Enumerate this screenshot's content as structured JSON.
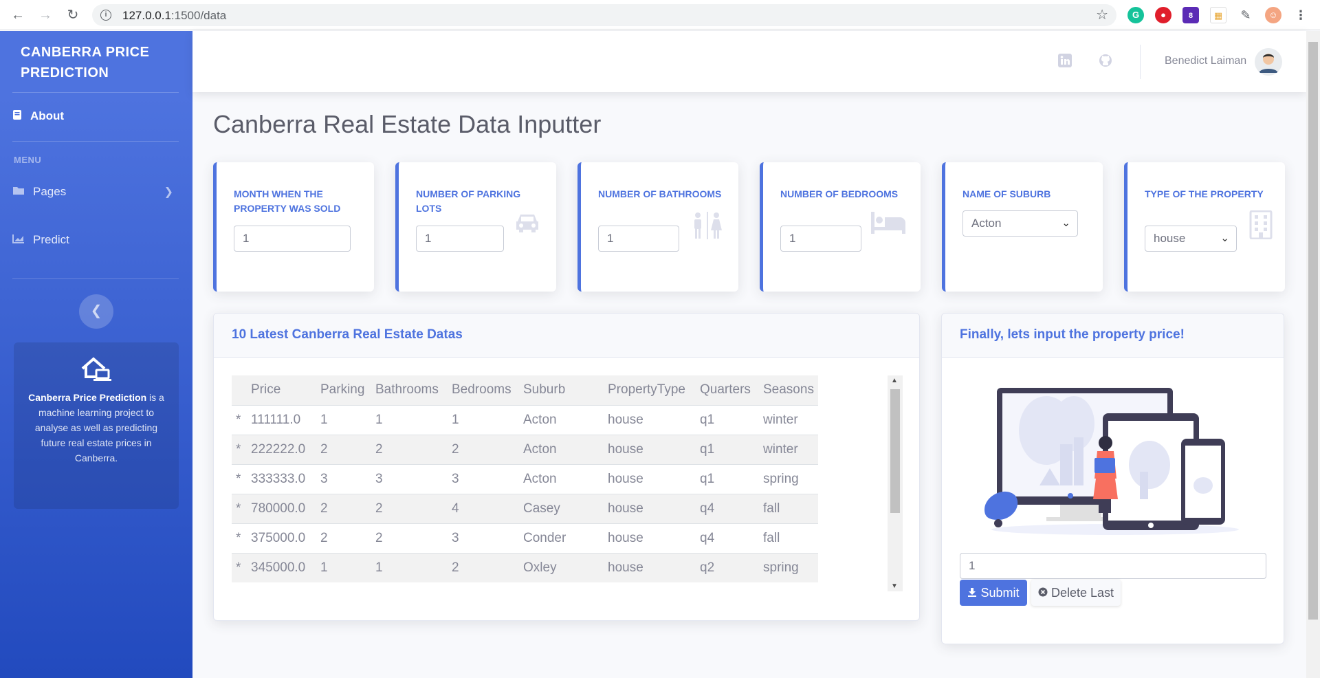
{
  "browser": {
    "url_host": "127.0.0.1",
    "url_path": ":1500/data",
    "ext_badge": "8"
  },
  "sidebar": {
    "brand": "CANBERRA PRICE PREDICTION",
    "about_label": "About",
    "menu_heading": "MENU",
    "pages_label": "Pages",
    "predict_label": "Predict",
    "card_title": "Canberra Price Prediction",
    "card_text": " is a machine learning project to analyse as well as predicting future real estate prices in Canberra."
  },
  "topbar": {
    "user_name": "Benedict Laiman"
  },
  "page": {
    "title": "Canberra Real Estate Data Inputter"
  },
  "inputs": {
    "month": {
      "label": "MONTH WHEN THE PROPERTY WAS SOLD",
      "value": "1"
    },
    "parking": {
      "label": "NUMBER OF PARKING LOTS",
      "value": "1"
    },
    "bathrooms": {
      "label": "NUMBER OF BATHROOMS",
      "value": "1"
    },
    "bedrooms": {
      "label": "NUMBER OF BEDROOMS",
      "value": "1"
    },
    "suburb": {
      "label": "NAME OF SUBURB",
      "value": "Acton"
    },
    "type": {
      "label": "TYPE OF THE PROPERTY",
      "value": "house"
    }
  },
  "table_card": {
    "title": "10 Latest Canberra Real Estate Datas",
    "columns": [
      "",
      "Price",
      "Parking",
      "Bathrooms",
      "Bedrooms",
      "Suburb",
      "PropertyType",
      "Quarters",
      "Seasons"
    ],
    "rows": [
      [
        "*",
        "111111.0",
        "1",
        "1",
        "1",
        "Acton",
        "house",
        "q1",
        "winter"
      ],
      [
        "*",
        "222222.0",
        "2",
        "2",
        "2",
        "Acton",
        "house",
        "q1",
        "winter"
      ],
      [
        "*",
        "333333.0",
        "3",
        "3",
        "3",
        "Acton",
        "house",
        "q1",
        "spring"
      ],
      [
        "*",
        "780000.0",
        "2",
        "2",
        "4",
        "Casey",
        "house",
        "q4",
        "fall"
      ],
      [
        "*",
        "375000.0",
        "2",
        "2",
        "3",
        "Conder",
        "house",
        "q4",
        "fall"
      ],
      [
        "*",
        "345000.0",
        "1",
        "1",
        "2",
        "Oxley",
        "house",
        "q2",
        "spring"
      ]
    ]
  },
  "price_card": {
    "title": "Finally, lets input the property price!",
    "price_value": "1",
    "submit_label": "Submit",
    "delete_label": "Delete Last"
  },
  "colors": {
    "primary": "#4e73df",
    "sidebar_gradient_end": "#224abe",
    "text": "#5a5c69"
  },
  "icons": [
    "book-icon",
    "folder-icon",
    "chart-icon",
    "house-laptop-icon",
    "linkedin-icon",
    "github-icon",
    "car-icon",
    "restroom-icon",
    "bed-icon",
    "building-icon",
    "download-icon",
    "times-circle-icon"
  ]
}
